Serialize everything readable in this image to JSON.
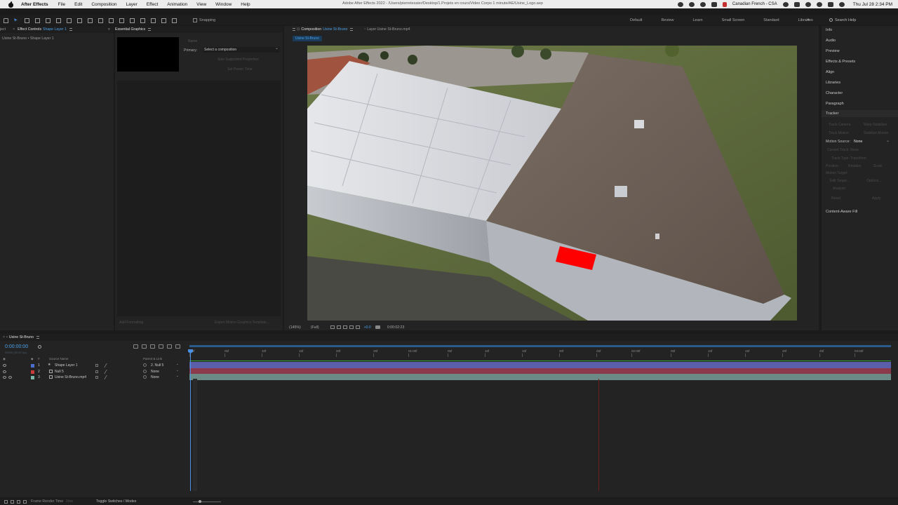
{
  "menubar": {
    "app_name": "After Effects",
    "items": [
      "File",
      "Edit",
      "Composition",
      "Layer",
      "Effect",
      "Animation",
      "View",
      "Window",
      "Help"
    ],
    "doc_title": "Adobe After Effects 2022 - /Users/pierretessier/Desktop/1.Projets en cours/Video Corpo 1 minute/AE/Usine_Logo.aep",
    "input_source": "Canadian French - CSA",
    "clock": "Thu Jul 28  2:34 PM"
  },
  "toolbar": {
    "snapping_label": "Snapping",
    "workspaces": [
      "Default",
      "Review",
      "Learn",
      "Small Screen",
      "Standard",
      "Libraries"
    ],
    "more": "»",
    "help_search": "Search Help"
  },
  "effect_controls": {
    "tab_project": "ject",
    "tab_label": "Effect Controls",
    "tab_layer": "Shape Layer 1",
    "subtitle": "Usine St-Bruno • Shape Layer 1",
    "expand": "»"
  },
  "essential_graphics": {
    "tab_label": "Essential Graphics",
    "name_placeholder": "Name",
    "primary_label": "Primary:",
    "primary_value": "Select a composition",
    "solo_button": "Solo Supported Properties",
    "poster_button": "Set Poster Time",
    "add_formatting": "Add Formatting",
    "export_button": "Export Motion Graphics Template..."
  },
  "composition": {
    "tab_prefix": "Composition",
    "tab_name": "Usine St-Bruno",
    "layer_tab": "Layer  Usine St-Bruno.mp4",
    "crumb": "Usine St-Bruno",
    "zoom": "(145%)",
    "resolution": "(Full)",
    "exposure": "+0.0",
    "timecode": "0:00:02:23"
  },
  "right_panels": {
    "items": [
      "Info",
      "Audio",
      "Preview",
      "Effects & Presets",
      "Align",
      "Libraries",
      "Character",
      "Paragraph"
    ],
    "tracker": "Tracker",
    "tracker_buttons": [
      "Track Camera",
      "Warp Stabilizer",
      "Track Motion",
      "Stabilize Motion"
    ],
    "motion_source_label": "Motion Source:",
    "motion_source_value": "None",
    "current_track": "Current Track:  None",
    "track_type": "Track Type:  Transform",
    "checks": [
      "Position",
      "Rotation",
      "Scale"
    ],
    "motion_target": "Motion Target:",
    "edit_target": "Edit Target...",
    "options": "Options...",
    "analyze": "Analyze:",
    "reset": "Reset",
    "apply": "Apply",
    "content_aware": "Content-Aware Fill"
  },
  "timeline": {
    "tab_label": "Usine St-Bruno",
    "timecode": "0:00:00:00",
    "fps": "00000 (30.00 fps)",
    "col_hash": "#",
    "col_source": "Source Name",
    "col_parent": "Parent & Link",
    "ruler": [
      ":00f",
      "05f",
      "10f",
      "15f",
      "20f",
      "25f",
      "01:00f",
      "05f",
      "10f",
      "15f",
      "20f",
      "25f",
      "02:00f",
      "05f",
      "10f",
      "15f",
      "20f",
      "25f",
      "03:00f"
    ],
    "layers": [
      {
        "num": "1",
        "name": "Shape Layer 1",
        "parent": "2. Null 5",
        "label_color": "#4a6fd0",
        "bar_color": "#5b5ea8"
      },
      {
        "num": "2",
        "name": "Null 5",
        "parent": "None",
        "label_color": "#c83c3c",
        "bar_color": "#8a3a4a"
      },
      {
        "num": "3",
        "name": "Usine St-Bruno.mp4",
        "parent": "None",
        "label_color": "#7ab6aa",
        "bar_color": "#6c8a86"
      }
    ]
  },
  "status": {
    "frame_render": "Frame Render Time",
    "ms": "1ms",
    "toggle": "Toggle Switches / Modes"
  },
  "colors": {
    "accent": "#4aa0e8",
    "shape_red": "#ff0000"
  }
}
